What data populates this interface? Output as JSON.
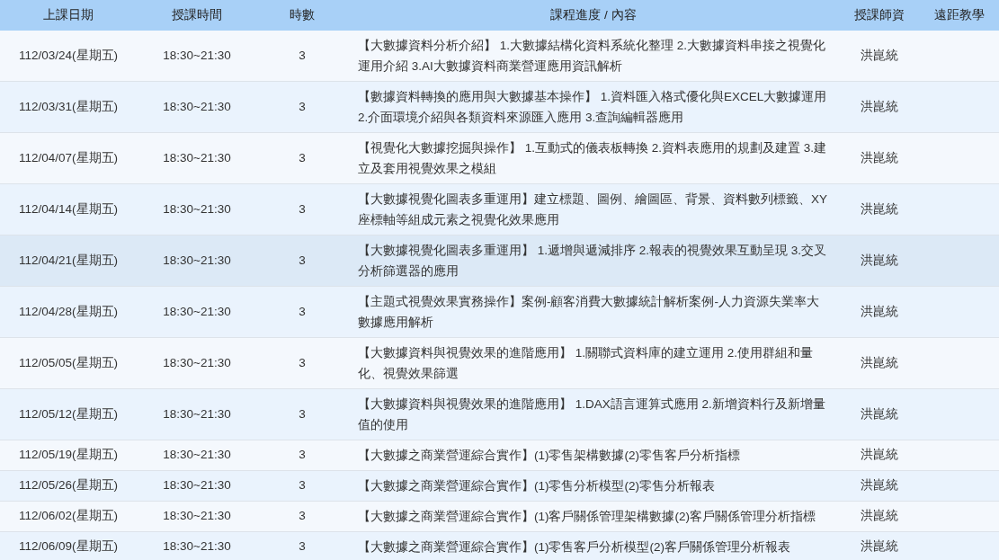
{
  "table": {
    "columns": [
      "上課日期",
      "授課時間",
      "時數",
      "課程進度 / 內容",
      "授課師資",
      "遠距教學"
    ],
    "rows": [
      {
        "date": "112/03/24(星期五)",
        "time": "18:30~21:30",
        "hours": "3",
        "content": "【大數據資料分析介紹】 1.大數據結構化資料系統化整理 2.大數據資料串接之視覺化運用介紹 3.AI大數據資料商業營運應用資訊解析",
        "teacher": "洪崑統",
        "selected": false
      },
      {
        "date": "112/03/31(星期五)",
        "time": "18:30~21:30",
        "hours": "3",
        "content": "【數據資料轉換的應用與大數據基本操作】 1.資料匯入格式優化與EXCEL大數據運用 2.介面環境介紹與各類資料來源匯入應用 3.查詢編輯器應用",
        "teacher": "洪崑統",
        "selected": false
      },
      {
        "date": "112/04/07(星期五)",
        "time": "18:30~21:30",
        "hours": "3",
        "content": "【視覺化大數據挖掘與操作】 1.互動式的儀表板轉換 2.資料表應用的規劃及建置 3.建立及套用視覺效果之模組",
        "teacher": "洪崑統",
        "selected": false
      },
      {
        "date": "112/04/14(星期五)",
        "time": "18:30~21:30",
        "hours": "3",
        "content": "【大數據視覺化圖表多重運用】建立標題、圖例、繪圖區、背景、資料數列標籤、XY座標軸等組成元素之視覺化效果應用",
        "teacher": "洪崑統",
        "selected": false
      },
      {
        "date": "112/04/21(星期五)",
        "time": "18:30~21:30",
        "hours": "3",
        "content": "【大數據視覺化圖表多重運用】 1.遞增與遞減排序 2.報表的視覺效果互動呈現 3.交叉分析篩選器的應用",
        "teacher": "洪崑統",
        "selected": true
      },
      {
        "date": "112/04/28(星期五)",
        "time": "18:30~21:30",
        "hours": "3",
        "content": "【主題式視覺效果實務操作】案例-顧客消費大數據統計解析案例-人力資源失業率大數據應用解析",
        "teacher": "洪崑統",
        "selected": false
      },
      {
        "date": "112/05/05(星期五)",
        "time": "18:30~21:30",
        "hours": "3",
        "content": "【大數據資料與視覺效果的進階應用】 1.關聯式資料庫的建立運用 2.使用群組和量化、視覺效果篩選",
        "teacher": "洪崑統",
        "selected": false
      },
      {
        "date": "112/05/12(星期五)",
        "time": "18:30~21:30",
        "hours": "3",
        "content": "【大數據資料與視覺效果的進階應用】 1.DAX語言運算式應用 2.新增資料行及新增量值的使用",
        "teacher": "洪崑統",
        "selected": false
      },
      {
        "date": "112/05/19(星期五)",
        "time": "18:30~21:30",
        "hours": "3",
        "content": "【大數據之商業營運綜合實作】(1)零售架構數據(2)零售客戶分析指標",
        "teacher": "洪崑統",
        "selected": false
      },
      {
        "date": "112/05/26(星期五)",
        "time": "18:30~21:30",
        "hours": "3",
        "content": "【大數據之商業營運綜合實作】(1)零售分析模型(2)零售分析報表",
        "teacher": "洪崑統",
        "selected": false
      },
      {
        "date": "112/06/02(星期五)",
        "time": "18:30~21:30",
        "hours": "3",
        "content": "【大數據之商業營運綜合實作】(1)客戶關係管理架構數據(2)客戶關係管理分析指標",
        "teacher": "洪崑統",
        "selected": false
      },
      {
        "date": "112/06/09(星期五)",
        "time": "18:30~21:30",
        "hours": "3",
        "content": "【大數據之商業營運綜合實作】(1)零售客戶分析模型(2)客戶關係管理分析報表",
        "teacher": "洪崑統",
        "selected": false
      }
    ]
  }
}
